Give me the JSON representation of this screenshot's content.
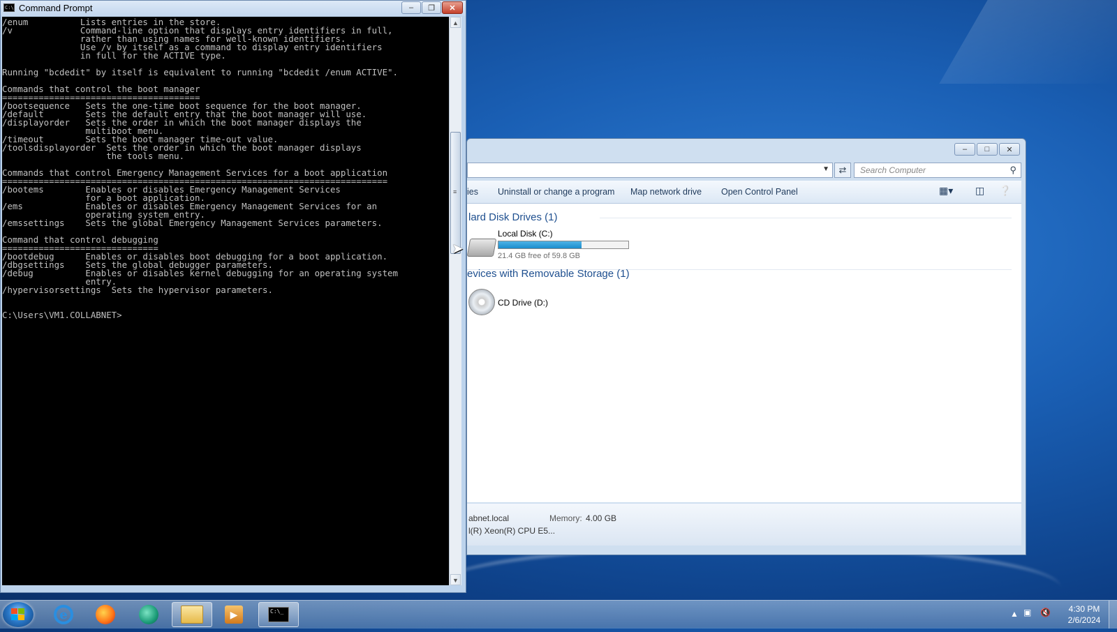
{
  "cmd": {
    "title": "Command Prompt",
    "output": "/enum          Lists entries in the store.\n/v             Command-line option that displays entry identifiers in full,\n               rather than using names for well-known identifiers.\n               Use /v by itself as a command to display entry identifiers\n               in full for the ACTIVE type.\n\nRunning \"bcdedit\" by itself is equivalent to running \"bcdedit /enum ACTIVE\".\n\nCommands that control the boot manager\n======================================\n/bootsequence   Sets the one-time boot sequence for the boot manager.\n/default        Sets the default entry that the boot manager will use.\n/displayorder   Sets the order in which the boot manager displays the\n                multiboot menu.\n/timeout        Sets the boot manager time-out value.\n/toolsdisplayorder  Sets the order in which the boot manager displays\n                    the tools menu.\n\nCommands that control Emergency Management Services for a boot application\n==========================================================================\n/bootems        Enables or disables Emergency Management Services\n                for a boot application.\n/ems            Enables or disables Emergency Management Services for an\n                operating system entry.\n/emssettings    Sets the global Emergency Management Services parameters.\n\nCommand that control debugging\n==============================\n/bootdebug      Enables or disables boot debugging for a boot application.\n/dbgsettings    Sets the global debugger parameters.\n/debug          Enables or disables kernel debugging for an operating system\n                entry.\n/hypervisorsettings  Sets the hypervisor parameters.\n\n\nC:\\Users\\VM1.COLLABNET>"
  },
  "explorer": {
    "search_placeholder": "Search Computer",
    "commands": {
      "properties_partial": "ies",
      "uninstall": "Uninstall or change a program",
      "map_drive": "Map network drive",
      "control_panel": "Open Control Panel"
    },
    "groups": {
      "hdd_title": "lard Disk Drives (1)",
      "removable_title": "evices with Removable Storage (1)"
    },
    "drives": {
      "c_name": "Local Disk (C:)",
      "c_free": "21.4 GB free of 59.8 GB",
      "c_used_fraction": 0.642,
      "d_name": "CD Drive (D:)"
    },
    "details": {
      "domain": "abnet.local",
      "memory_label": "Memory:",
      "memory_value": "4.00 GB",
      "cpu": "l(R) Xeon(R) CPU E5..."
    }
  },
  "taskbar": {
    "time": "4:30 PM",
    "date": "2/6/2024",
    "cmd_glyph": "C:\\_"
  },
  "colors": {
    "desktop": "#1a5fb4",
    "console_bg": "#000000",
    "console_fg": "#c0c0c0",
    "progress": "#1b8ccc"
  }
}
